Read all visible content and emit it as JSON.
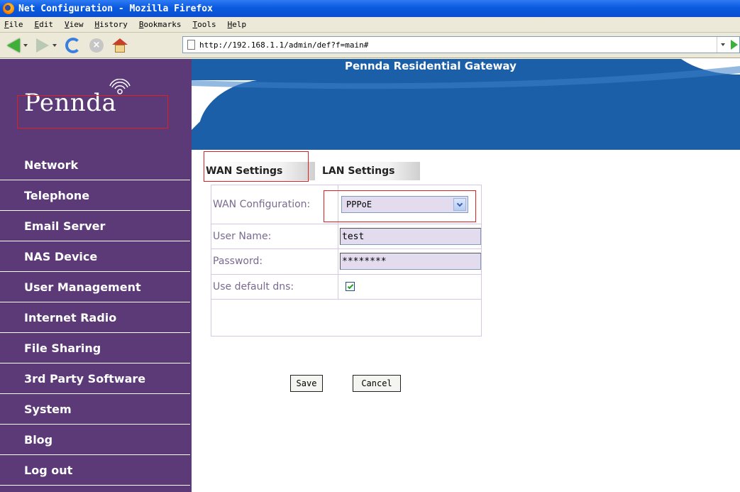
{
  "browser": {
    "window_title": "Net Configuration - Mozilla Firefox",
    "menu": [
      "File",
      "Edit",
      "View",
      "History",
      "Bookmarks",
      "Tools",
      "Help"
    ],
    "url": "http://192.168.1.1/admin/def?f=main#"
  },
  "banner": {
    "logo_text": "Pennda",
    "title": "Pennda Residential Gateway"
  },
  "sidebar": {
    "items": [
      {
        "label": "Network"
      },
      {
        "label": "Telephone"
      },
      {
        "label": "Email Server"
      },
      {
        "label": "NAS Device"
      },
      {
        "label": "User Management"
      },
      {
        "label": "Internet Radio"
      },
      {
        "label": "File Sharing"
      },
      {
        "label": "3rd Party Software"
      },
      {
        "label": "System"
      },
      {
        "label": "Blog"
      },
      {
        "label": "Log out"
      }
    ]
  },
  "tabs": {
    "wan": "WAN Settings",
    "lan": "LAN Settings"
  },
  "form": {
    "wan_config_label": "WAN Configuration:",
    "wan_config_value": "PPPoE",
    "username_label": "User Name:",
    "username_value": "test",
    "password_label": "Password:",
    "password_value": "********",
    "default_dns_label": "Use default dns:",
    "default_dns_checked": true,
    "save_label": "Save",
    "cancel_label": "Cancel"
  },
  "colors": {
    "sidebar_bg": "#5c3a78",
    "banner_blue": "#1a5fa8",
    "highlight_red": "#e02020"
  }
}
